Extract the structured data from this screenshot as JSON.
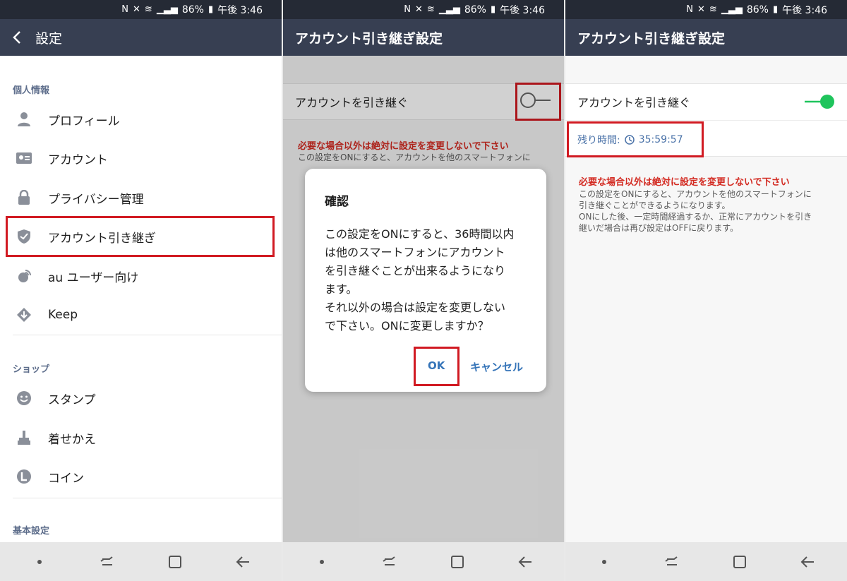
{
  "status_bar": {
    "battery": "86%",
    "time": "午後 3:46"
  },
  "screen1": {
    "appbar_title": "設定",
    "sections": [
      {
        "title": "個人情報"
      },
      {
        "title": "ショップ"
      },
      {
        "title": "基本設定"
      }
    ],
    "items": [
      {
        "label": "プロフィール",
        "icon": "person-icon"
      },
      {
        "label": "アカウント",
        "icon": "id-card-icon"
      },
      {
        "label": "プライバシー管理",
        "icon": "lock-icon"
      },
      {
        "label": "アカウント引き継ぎ",
        "icon": "shield-check-icon"
      },
      {
        "label": "au ユーザー向け",
        "icon": "satellite-icon"
      },
      {
        "label": "Keep",
        "icon": "keep-icon"
      },
      {
        "label": "スタンプ",
        "icon": "smiley-icon"
      },
      {
        "label": "着せかえ",
        "icon": "brush-icon"
      },
      {
        "label": "コイン",
        "icon": "coin-icon"
      }
    ]
  },
  "screen2": {
    "appbar_title": "アカウント引き継ぎ設定",
    "toggle_label": "アカウントを引き継ぐ",
    "warning_title": "必要な場合以外は絶対に設定を変更しないで下さい",
    "warning_body_partial": "この設定をONにすると、アカウントを他のスマートフォンに",
    "dialog": {
      "title": "確認",
      "body": "この設定をONにすると、36時間以内\nは他のスマートフォンにアカウント\nを引き継ぐことが出来るようになり\nます。\nそれ以外の場合は設定を変更しない\nで下さい。ONに変更しますか？",
      "ok": "OK",
      "cancel": "キャンセル"
    }
  },
  "screen3": {
    "appbar_title": "アカウント引き継ぎ設定",
    "toggle_label": "アカウントを引き継ぐ",
    "toggle_on": true,
    "remaining_label": "残り時間:",
    "remaining_time": "35:59:57",
    "warning_title": "必要な場合以外は絶対に設定を変更しないで下さい",
    "warning_body": "この設定をONにすると、アカウントを他のスマートフォンに\n引き継ぐことができるようになります。\nONにした後、一定時間経過するか、正常にアカウントを引き\n継いだ場合は再び設定はOFFに戻ります。"
  },
  "colors": {
    "appbar": "#373f52",
    "statusbar": "#252a35",
    "accent_red": "#d11a22",
    "link_blue": "#3574b8",
    "toggle_green": "#1fc45c"
  }
}
